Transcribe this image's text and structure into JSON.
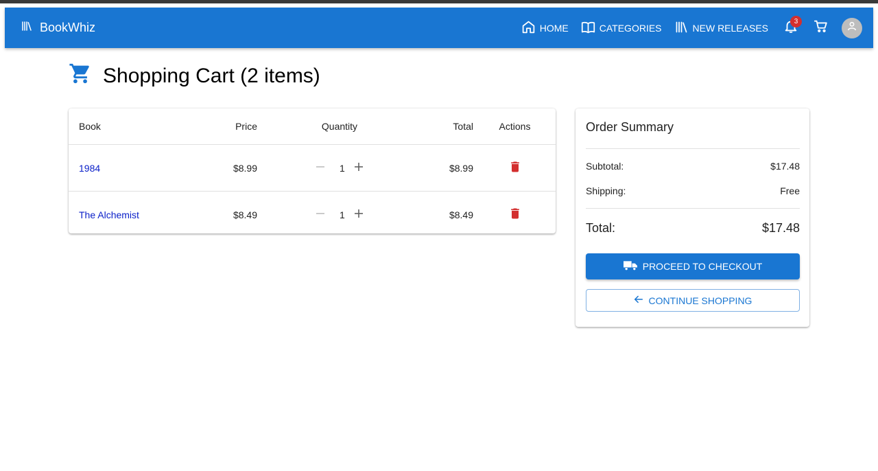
{
  "app": {
    "brand": "BookWhiz",
    "nav": [
      {
        "label": "HOME",
        "icon": "home-icon"
      },
      {
        "label": "CATEGORIES",
        "icon": "open-book-icon"
      },
      {
        "label": "NEW RELEASES",
        "icon": "library-icon"
      }
    ],
    "notifications_count": "3",
    "accent": "#1976d2",
    "badge_color": "#d32f2f",
    "delete_color": "#d32f2f"
  },
  "cart": {
    "title": "Shopping Cart (2 items)",
    "columns": [
      "Book",
      "Price",
      "Quantity",
      "Total",
      "Actions"
    ],
    "items": [
      {
        "book": "1984",
        "price": "$8.99",
        "quantity": "1",
        "total": "$8.99"
      },
      {
        "book": "The Alchemist",
        "price": "$8.49",
        "quantity": "1",
        "total": "$8.49"
      }
    ]
  },
  "summary": {
    "title": "Order Summary",
    "subtotal_label": "Subtotal:",
    "subtotal_value": "$17.48",
    "shipping_label": "Shipping:",
    "shipping_value": "Free",
    "total_label": "Total:",
    "total_value": "$17.48",
    "checkout_label": "PROCEED TO CHECKOUT",
    "continue_label": "CONTINUE SHOPPING"
  }
}
